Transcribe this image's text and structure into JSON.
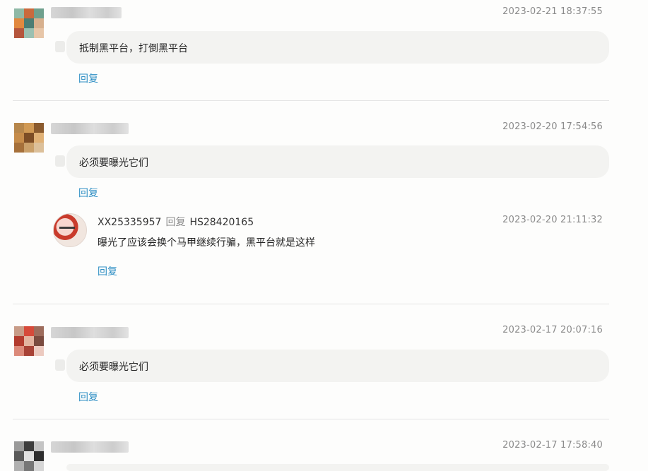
{
  "comments": [
    {
      "time": "2023-02-21 18:37:55",
      "text": "抵制黑平台，打倒黑平台",
      "reply_label": "回复",
      "avatar_colors": [
        "#8fb9a6",
        "#c96a3d",
        "#6fa08d",
        "#e2893f",
        "#4b7d74",
        "#d7b08e",
        "#b5563d",
        "#9bc0b1",
        "#e7c6a8"
      ]
    },
    {
      "time": "2023-02-20 17:54:56",
      "text": "必须要曝光它们",
      "reply_label": "回复",
      "avatar_colors": [
        "#b7874c",
        "#d19a55",
        "#8b5b2e",
        "#c68c4a",
        "#7d4d25",
        "#e0b176",
        "#a6703a",
        "#caa06a",
        "#dcc09a"
      ],
      "sub_reply": {
        "author": "XX25335957",
        "reply_word": "回复",
        "target": "HS28420165",
        "time": "2023-02-20 21:11:32",
        "text": "曝光了应该会换个马甲继续行骗，黑平台就是这样",
        "reply_label": "回复"
      }
    },
    {
      "time": "2023-02-17 20:07:16",
      "text": "必须要曝光它们",
      "reply_label": "回复",
      "avatar_colors": [
        "#c89c88",
        "#d64a3a",
        "#9d6c5c",
        "#b33b2e",
        "#e3b39f",
        "#7a4b3f",
        "#dc8a7a",
        "#a84236",
        "#eccac0"
      ]
    },
    {
      "time": "2023-02-17 17:58:40",
      "avatar_colors": [
        "#9a9a9a",
        "#3d3d3d",
        "#c4c4c4",
        "#5a5a5a",
        "#e2e2e2",
        "#2e2e2e",
        "#b0b0b0",
        "#777777",
        "#d6d6d6"
      ]
    }
  ]
}
